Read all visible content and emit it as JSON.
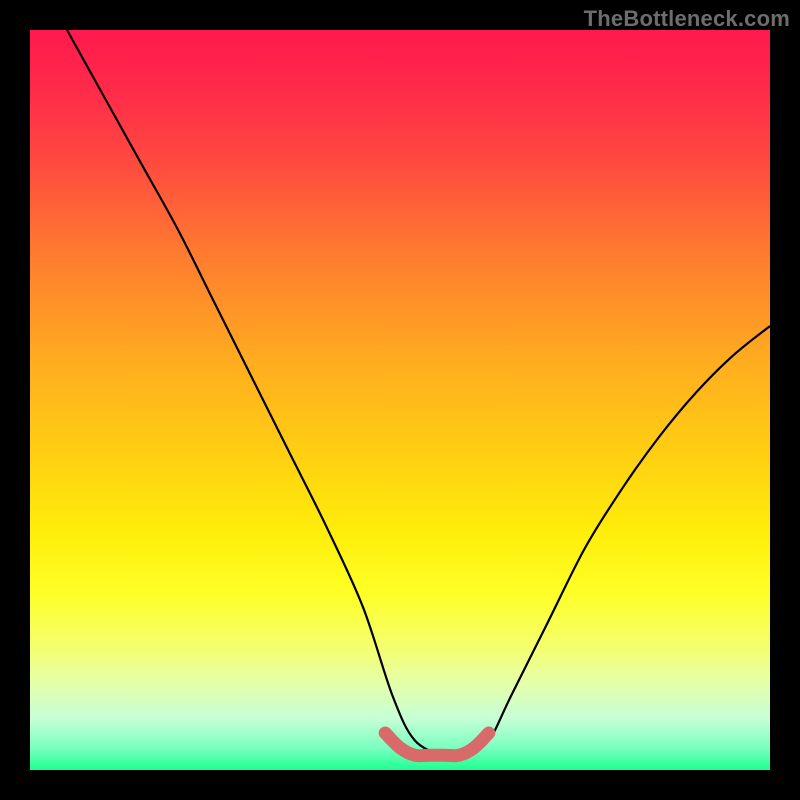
{
  "watermark": "TheBottleneck.com",
  "chart_data": {
    "type": "line",
    "title": "",
    "xlabel": "",
    "ylabel": "",
    "xlim": [
      0,
      100
    ],
    "ylim": [
      0,
      100
    ],
    "series": [
      {
        "name": "black-curve",
        "x": [
          5,
          10,
          15,
          20,
          25,
          30,
          35,
          40,
          45,
          49,
          52,
          56,
          59,
          62,
          65,
          70,
          75,
          80,
          85,
          90,
          95,
          100
        ],
        "y": [
          100,
          91,
          82,
          73,
          63,
          53,
          43,
          33,
          22,
          10,
          4,
          2,
          2,
          4,
          10,
          20,
          30,
          38,
          45,
          51,
          56,
          60
        ]
      },
      {
        "name": "red-marker-band",
        "x": [
          48,
          50,
          52,
          54,
          56,
          58,
          60,
          62
        ],
        "y": [
          5,
          3,
          2,
          2,
          2,
          2,
          3,
          5
        ]
      }
    ],
    "gradient_stops": [
      {
        "pos": 0,
        "color": "#ff1a4d"
      },
      {
        "pos": 8,
        "color": "#ff2a4a"
      },
      {
        "pos": 18,
        "color": "#ff4a3f"
      },
      {
        "pos": 30,
        "color": "#ff7a30"
      },
      {
        "pos": 45,
        "color": "#ffad1f"
      },
      {
        "pos": 58,
        "color": "#ffd111"
      },
      {
        "pos": 68,
        "color": "#ffee0a"
      },
      {
        "pos": 76,
        "color": "#feff26"
      },
      {
        "pos": 83,
        "color": "#f5ff6a"
      },
      {
        "pos": 88,
        "color": "#e6ffa6"
      },
      {
        "pos": 93,
        "color": "#c7ffd6"
      },
      {
        "pos": 97,
        "color": "#7affc0"
      },
      {
        "pos": 100,
        "color": "#1eff90"
      }
    ],
    "colors": {
      "curve": "#000000",
      "marker": "#d96a6a",
      "frame": "#000000"
    }
  }
}
